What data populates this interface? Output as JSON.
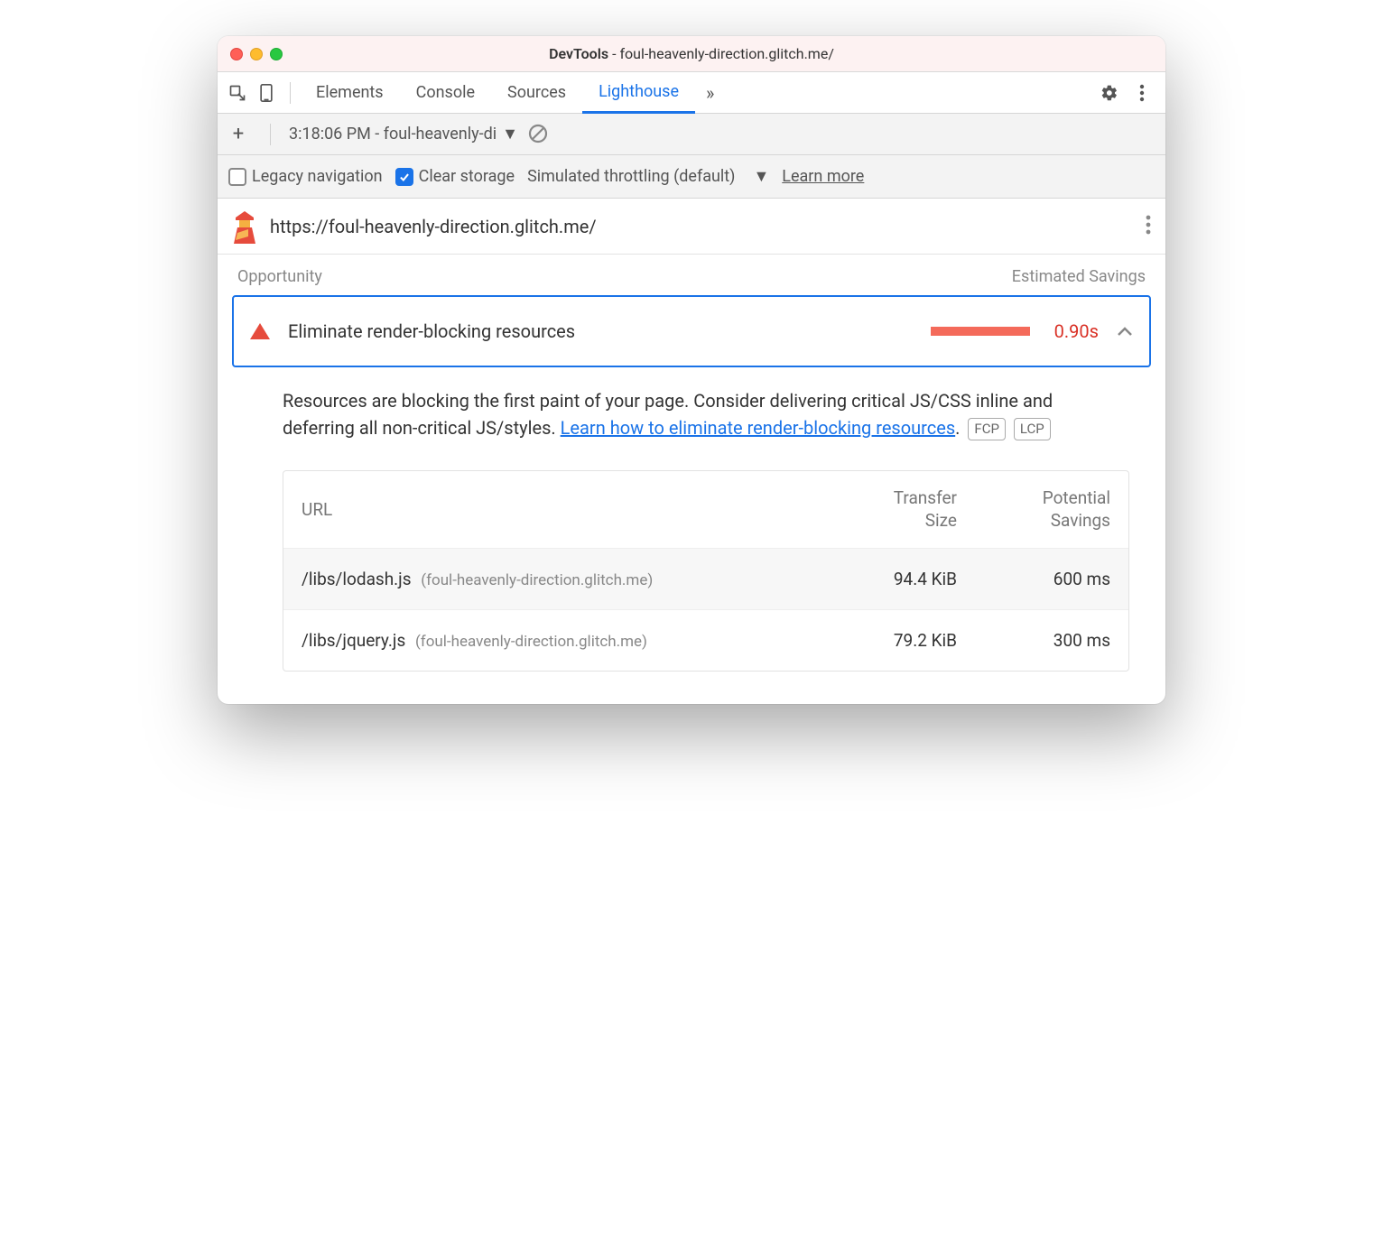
{
  "window": {
    "title_prefix": "DevTools",
    "title_suffix": "- foul-heavenly-direction.glitch.me/"
  },
  "tabs": {
    "items": [
      "Elements",
      "Console",
      "Sources",
      "Lighthouse"
    ],
    "active_index": 3
  },
  "subtoolbar": {
    "report_label": "3:18:06 PM - foul-heavenly-di"
  },
  "options": {
    "legacy_navigation": {
      "label": "Legacy navigation",
      "checked": false
    },
    "clear_storage": {
      "label": "Clear storage",
      "checked": true
    },
    "throttling_label": "Simulated throttling (default)",
    "learn_more": "Learn more"
  },
  "url_row": {
    "url": "https://foul-heavenly-direction.glitch.me/"
  },
  "opportunity": {
    "header_left": "Opportunity",
    "header_right": "Estimated Savings",
    "title": "Eliminate render-blocking resources",
    "savings": "0.90s",
    "description_1": "Resources are blocking the first paint of your page. Consider delivering critical JS/CSS inline and deferring all non-critical JS/styles. ",
    "link_text": "Learn how to eliminate render-blocking resources",
    "description_2": ". ",
    "tags": [
      "FCP",
      "LCP"
    ],
    "table": {
      "headers": {
        "url": "URL",
        "transfer": "Transfer Size",
        "savings": "Potential Savings"
      },
      "rows": [
        {
          "path": "/libs/lodash.js",
          "host": "(foul-heavenly-direction.glitch.me)",
          "transfer": "94.4 KiB",
          "savings": "600 ms"
        },
        {
          "path": "/libs/jquery.js",
          "host": "(foul-heavenly-direction.glitch.me)",
          "transfer": "79.2 KiB",
          "savings": "300 ms"
        }
      ]
    }
  }
}
